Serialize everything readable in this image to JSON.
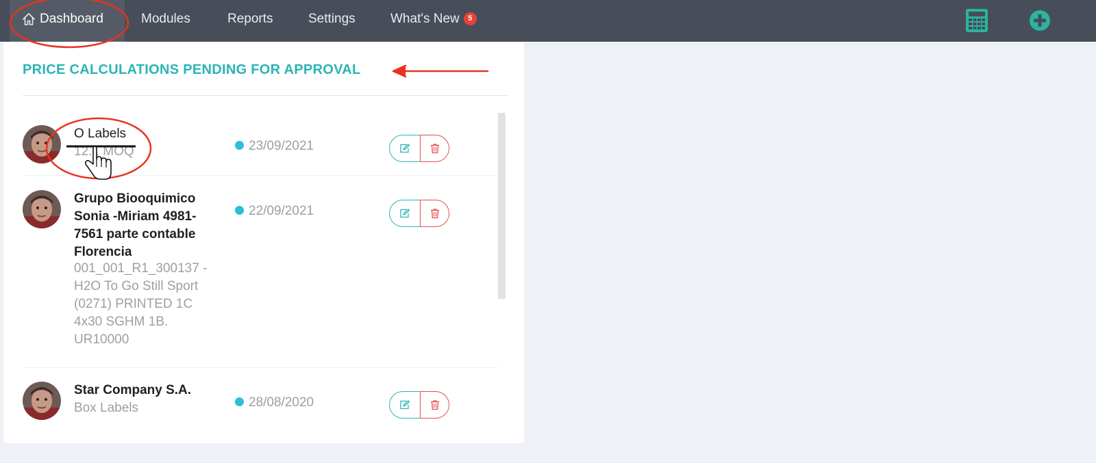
{
  "nav": {
    "dashboard": "Dashboard",
    "modules": "Modules",
    "reports": "Reports",
    "settings": "Settings",
    "whats_new": "What's New",
    "whats_new_badge": "5",
    "calculator_icon": "calculator-icon",
    "add_icon": "plus-circle-icon"
  },
  "panel": {
    "title": "PRICE CALCULATIONS PENDING FOR APPROVAL",
    "rows": [
      {
        "name": "O Labels",
        "desc": "12... MOQ",
        "date": "23/09/2021"
      },
      {
        "name": "Grupo Biooquimico Sonia -Miriam 4981-7561 parte contable Florencia",
        "desc": "001_001_R1_300137 - H2O To Go Still Sport (0271) PRINTED 1C 4x30 SGHM 1B. UR10000",
        "date": "22/09/2021"
      },
      {
        "name": "Star Company S.A.",
        "desc": "Box Labels",
        "date": "28/08/2020"
      }
    ]
  },
  "colors": {
    "topbar": "#474e59",
    "accent": "#2bb4b4",
    "danger": "#e84c4c",
    "date_dot": "#2bc0d8",
    "annotation": "#e8321e"
  }
}
